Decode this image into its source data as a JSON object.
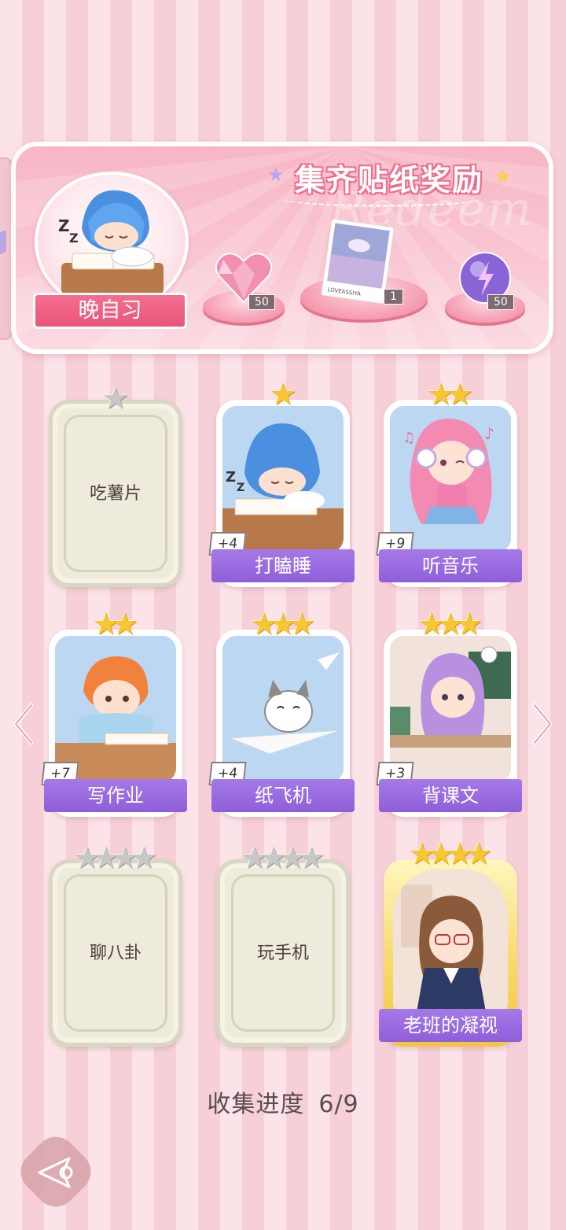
{
  "reward_banner": {
    "title": "集齐贴纸奖励",
    "watermark": "Redeem",
    "current_sticker_name": "晚自习",
    "rewards": [
      {
        "icon": "heart-gem-icon",
        "count": "50"
      },
      {
        "icon": "photo-card-icon",
        "count": "1",
        "caption": "LOVEASSIYA"
      },
      {
        "icon": "purple-orb-icon",
        "count": "50"
      }
    ]
  },
  "stickers": [
    {
      "name": "吃薯片",
      "stars": 1,
      "collected": false
    },
    {
      "name": "打瞌睡",
      "stars": 1,
      "collected": true,
      "bonus": "+4"
    },
    {
      "name": "听音乐",
      "stars": 2,
      "collected": true,
      "bonus": "+9"
    },
    {
      "name": "写作业",
      "stars": 2,
      "collected": true,
      "bonus": "+7"
    },
    {
      "name": "纸飞机",
      "stars": 3,
      "collected": true,
      "bonus": "+4"
    },
    {
      "name": "背课文",
      "stars": 3,
      "collected": true,
      "bonus": "+3"
    },
    {
      "name": "聊八卦",
      "stars": 4,
      "collected": false
    },
    {
      "name": "玩手机",
      "stars": 4,
      "collected": false
    },
    {
      "name": "老班的凝视",
      "stars": 4,
      "collected": true
    }
  ],
  "progress": {
    "label": "收集进度",
    "value": "6/9"
  },
  "colors": {
    "accent_pink": "#ee6d8e",
    "label_purple": "#9a68e0",
    "star_gold": "#f7c634",
    "star_gray": "#c8c6c6"
  }
}
